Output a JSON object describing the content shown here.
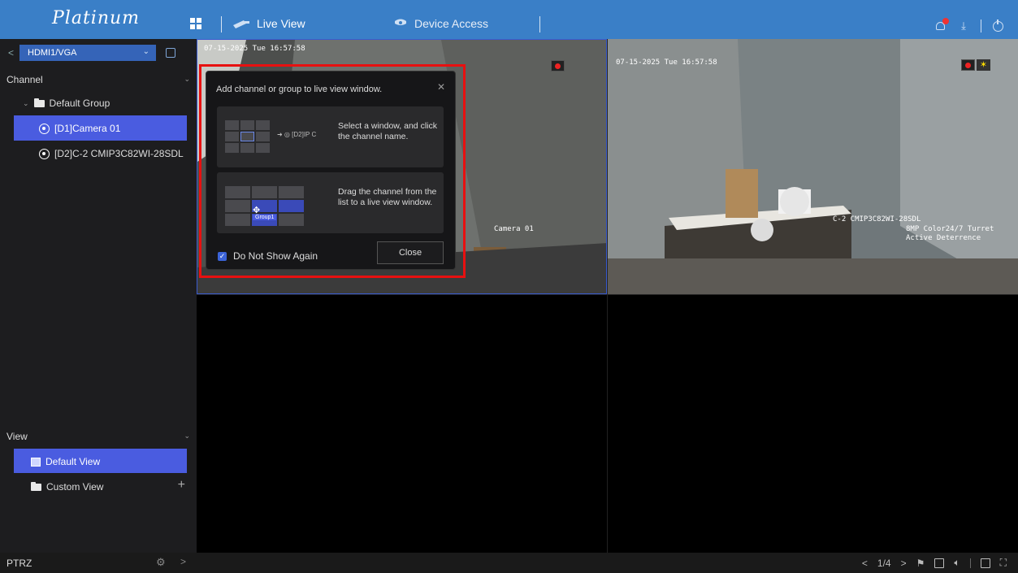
{
  "app": {
    "logo": "Platinum"
  },
  "topnav": {
    "items": [
      {
        "label": "Live View",
        "icon": "camera-icon",
        "active": true
      },
      {
        "label": "Device Access",
        "icon": "device-camera-icon",
        "active": false
      }
    ],
    "notification_badge": "1"
  },
  "sidebar": {
    "source": "HDMI1/VGA",
    "channel_section": "Channel",
    "group": "Default Group",
    "channels": [
      {
        "label": "[D1]Camera 01",
        "selected": true
      },
      {
        "label": "[D2]C-2 CMIP3C82WI-28SDL",
        "selected": false
      }
    ],
    "view_section": "View",
    "views": [
      {
        "label": "Default View",
        "selected": true
      },
      {
        "label": "Custom View",
        "selected": false
      }
    ]
  },
  "bottombar": {
    "ptrz_label": "PTRZ",
    "page": "1/4"
  },
  "tiles": [
    {
      "timestamp": "07-15-2025 Tue 16:57:58",
      "camera_name": "Camera 01"
    },
    {
      "timestamp": "07-15-2025 Tue 16:57:58",
      "camera_name": "C-2 CMIP3C82WI-28SDL",
      "subtitle_line1": "8MP Color24/7 Turret",
      "subtitle_line2": "Active Deterrence"
    }
  ],
  "dialog": {
    "title": "Add channel or group to live view window.",
    "tip1": "Select a window, and click the channel name.",
    "tip1_channel_sample": "[D2]IP C",
    "tip2": "Drag the channel from the list to a live view window.",
    "tip2_group_sample": "Group1",
    "checkbox_label": "Do Not Show Again",
    "checkbox_checked": true,
    "close_label": "Close"
  },
  "colors": {
    "topbar": "#3a7fc7",
    "selection": "#4a5ce0",
    "highlight_box": "#e81010"
  }
}
